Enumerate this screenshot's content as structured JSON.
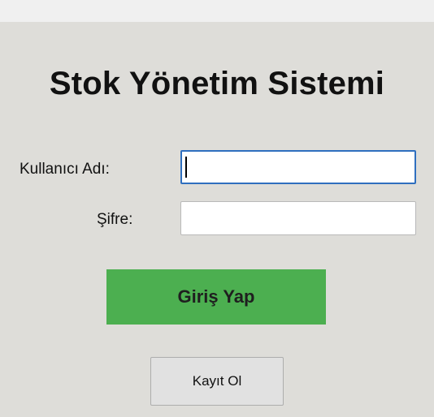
{
  "app": {
    "title": "Stok Yönetim Sistemi"
  },
  "login_form": {
    "username_label": "Kullanıcı Adı:",
    "username_value": "",
    "password_label": "Şifre:",
    "password_value": "",
    "login_button_label": "Giriş Yap",
    "register_button_label": "Kayıt Ol"
  },
  "colors": {
    "panel_background": "#deddd9",
    "login_button": "#4caf50",
    "focused_field_border": "#2f6fbf"
  }
}
